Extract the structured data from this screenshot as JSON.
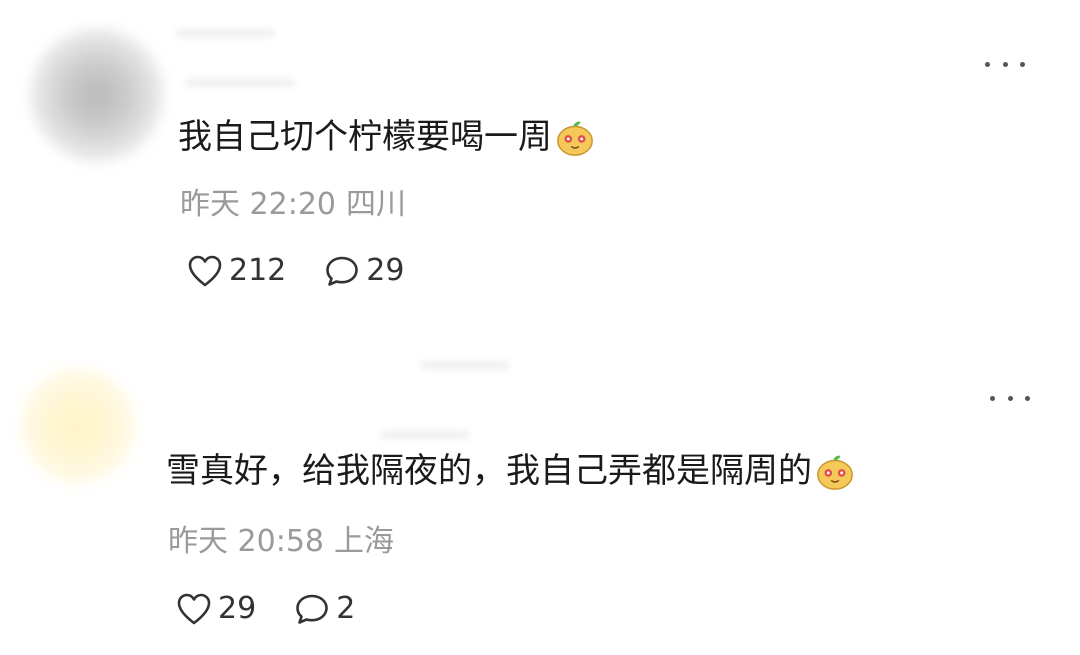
{
  "comments": [
    {
      "text": "我自己切个柠檬要喝一周",
      "emoji": "lemon-face-emoji",
      "time": "昨天 22:20",
      "location": "四川",
      "likes": "212",
      "replies": "29"
    },
    {
      "text": "雪真好，给我隔夜的，我自己弄都是隔周的",
      "emoji": "lemon-face-emoji",
      "time": "昨天 20:58",
      "location": "上海",
      "likes": "29",
      "replies": "2"
    }
  ],
  "icons": {
    "like": "heart-outline-icon",
    "reply": "speech-bubble-icon",
    "more": "more-dots-icon"
  },
  "colors": {
    "text": "#1a1a1a",
    "meta": "#9a9a9a",
    "action": "#333333"
  }
}
